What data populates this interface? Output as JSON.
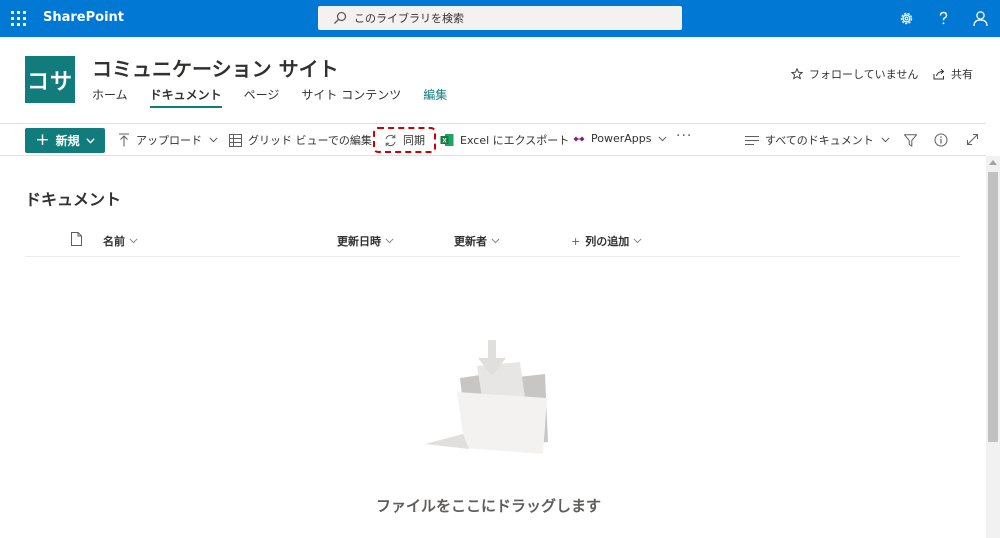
{
  "suite": {
    "brand": "SharePoint",
    "search_placeholder": "このライブラリを検索"
  },
  "site": {
    "logo_text": "コサ",
    "title": "コミュニケーション サイト",
    "nav": [
      {
        "label": "ホーム"
      },
      {
        "label": "ドキュメント"
      },
      {
        "label": "ページ"
      },
      {
        "label": "サイト コンテンツ"
      },
      {
        "label": "編集"
      }
    ],
    "follow_label": "フォローしていません",
    "share_label": "共有"
  },
  "commands": {
    "new_label": "新規",
    "upload_label": "アップロード",
    "grid_label": "グリッド ビューでの編集",
    "sync_label": "同期",
    "excel_label": "Excel にエクスポート",
    "powerapps_label": "PowerApps",
    "more_label": "···",
    "view_label": "すべてのドキュメント"
  },
  "library": {
    "title": "ドキュメント",
    "columns": [
      "名前",
      "更新日時",
      "更新者",
      "列の追加"
    ],
    "add_column_plus": "+",
    "empty_message": "ファイルをここにドラッグします"
  },
  "colors": {
    "suite_bar": "#0078d4",
    "theme": "#127c7c",
    "highlight": "#d00000"
  },
  "icons": [
    "waffle-icon",
    "search-icon",
    "settings-icon",
    "help-icon",
    "person-icon",
    "star-icon",
    "share-icon",
    "upload-icon",
    "grid-icon",
    "sync-icon",
    "excel-icon",
    "powerapps-icon",
    "view-lines-icon",
    "filter-icon",
    "info-icon",
    "expand-icon",
    "file-icon",
    "chevron-down-icon",
    "empty-folder-icon"
  ]
}
